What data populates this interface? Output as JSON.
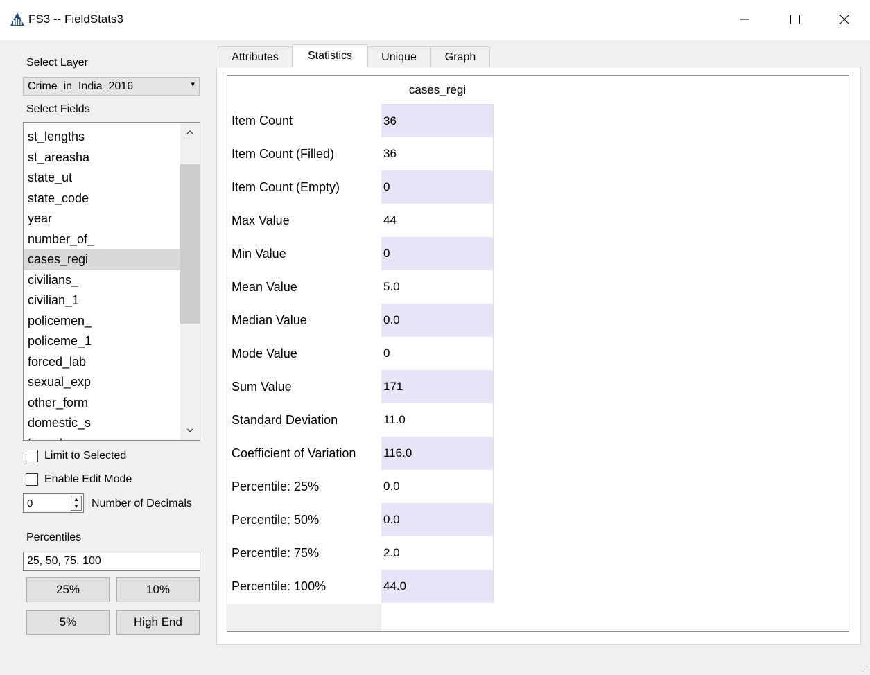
{
  "window": {
    "title": "FS3 -- FieldStats3",
    "icon": "bar-chart-app-icon",
    "controls": [
      "minimize-icon",
      "maximize-icon",
      "close-icon"
    ]
  },
  "left_panel": {
    "select_layer_label": "Select Layer",
    "layer_value": "Crime_in_India_2016",
    "select_fields_label": "Select Fields",
    "fields": [
      "st_lengths",
      "st_areasha",
      "state_ut",
      "state_code",
      "year",
      "number_of_",
      "cases_regi",
      "civilians_",
      "civilian_1",
      "policemen_",
      "policeme_1",
      "forced_lab",
      "sexual_exp",
      "other_form",
      "domestic_s",
      "forced_m"
    ],
    "selected_field": "cases_regi",
    "limit_to_selected_label": "Limit to Selected",
    "limit_to_selected_checked": false,
    "enable_edit_mode_label": "Enable Edit Mode",
    "enable_edit_mode_checked": false,
    "decimals_value": "0",
    "decimals_label": "Number of Decimals",
    "percentiles_label": "Percentiles",
    "percentiles_value": "25, 50, 75, 100",
    "buttons": {
      "p25": "25%",
      "p10": "10%",
      "p5": "5%",
      "high_end": "High End"
    }
  },
  "tabs": [
    "Attributes",
    "Statistics",
    "Unique",
    "Graph"
  ],
  "active_tab": "Statistics",
  "stats_table": {
    "column_header": "cases_regi",
    "rows": [
      {
        "label": "Item Count",
        "value": "36"
      },
      {
        "label": "Item Count (Filled)",
        "value": "36"
      },
      {
        "label": "Item Count (Empty)",
        "value": "0"
      },
      {
        "label": "Max Value",
        "value": "44"
      },
      {
        "label": "Min Value",
        "value": "0"
      },
      {
        "label": "Mean Value",
        "value": "5.0"
      },
      {
        "label": "Median Value",
        "value": "0.0"
      },
      {
        "label": "Mode Value",
        "value": "0"
      },
      {
        "label": "Sum Value",
        "value": "171"
      },
      {
        "label": "Standard Deviation",
        "value": "11.0"
      },
      {
        "label": "Coefficient of Variation",
        "value": "116.0"
      },
      {
        "label": "Percentile: 25%",
        "value": "0.0"
      },
      {
        "label": "Percentile: 50%",
        "value": "0.0"
      },
      {
        "label": "Percentile: 75%",
        "value": "2.0"
      },
      {
        "label": "Percentile: 100%",
        "value": "44.0"
      }
    ]
  },
  "colors": {
    "alt_row": "#e6e6f8",
    "selected_item": "#d9d9d9",
    "background": "#f0f0f0"
  }
}
